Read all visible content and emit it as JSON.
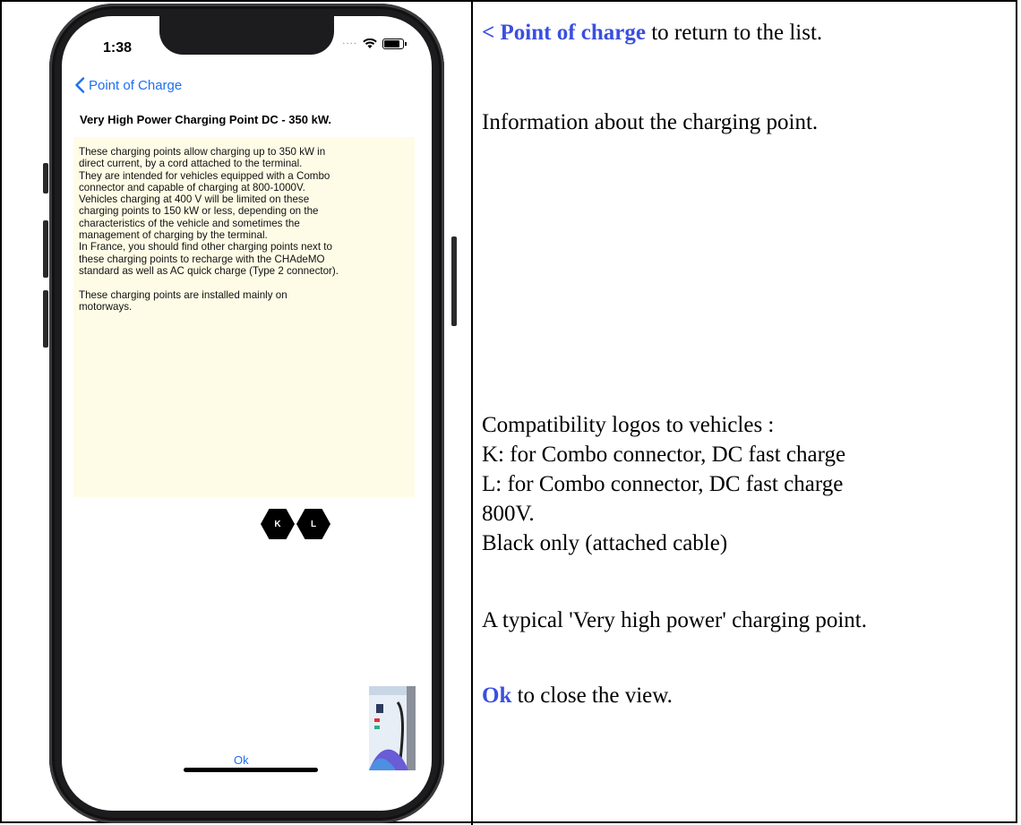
{
  "phone": {
    "status_time": "1:38",
    "nav_back_label": "Point of Charge",
    "title": "Very High Power Charging Point DC - 350 kW.",
    "description": "These charging points allow charging up to 350 kW in\ndirect current, by a cord attached to the terminal.\nThey are intended for vehicles equipped with a Combo\nconnector and capable of charging at 800-1000V.\nVehicles charging at 400 V will be limited on these\ncharging points to 150 kW or less, depending on the\ncharacteristics of the vehicle and sometimes the\nmanagement of charging by the terminal.\nIn France, you should find other charging points next to\nthese charging points to recharge with the CHAdeMO\nstandard as well as AC quick charge (Type 2 connector).\n\nThese charging points are installed mainly on\nmotorways.",
    "logos": [
      "K",
      "L"
    ],
    "ok_label": "Ok",
    "accent_color": "#1e6ff0",
    "description_bg": "#fefce6"
  },
  "instructions": {
    "back_link": "< Point of charge",
    "back_rest": " to return to the list.",
    "info": "Information about the charging point.",
    "compat_title": "Compatibility logos to vehicles :",
    "compat_k": "K: for Combo connector, DC fast charge",
    "compat_l_1": "L: for Combo connector, DC fast charge",
    "compat_l_2": "800V.",
    "compat_note": "Black only (attached cable)",
    "typical": "A typical 'Very high power' charging point.",
    "ok_link": "Ok",
    "ok_rest": " to close the view."
  }
}
